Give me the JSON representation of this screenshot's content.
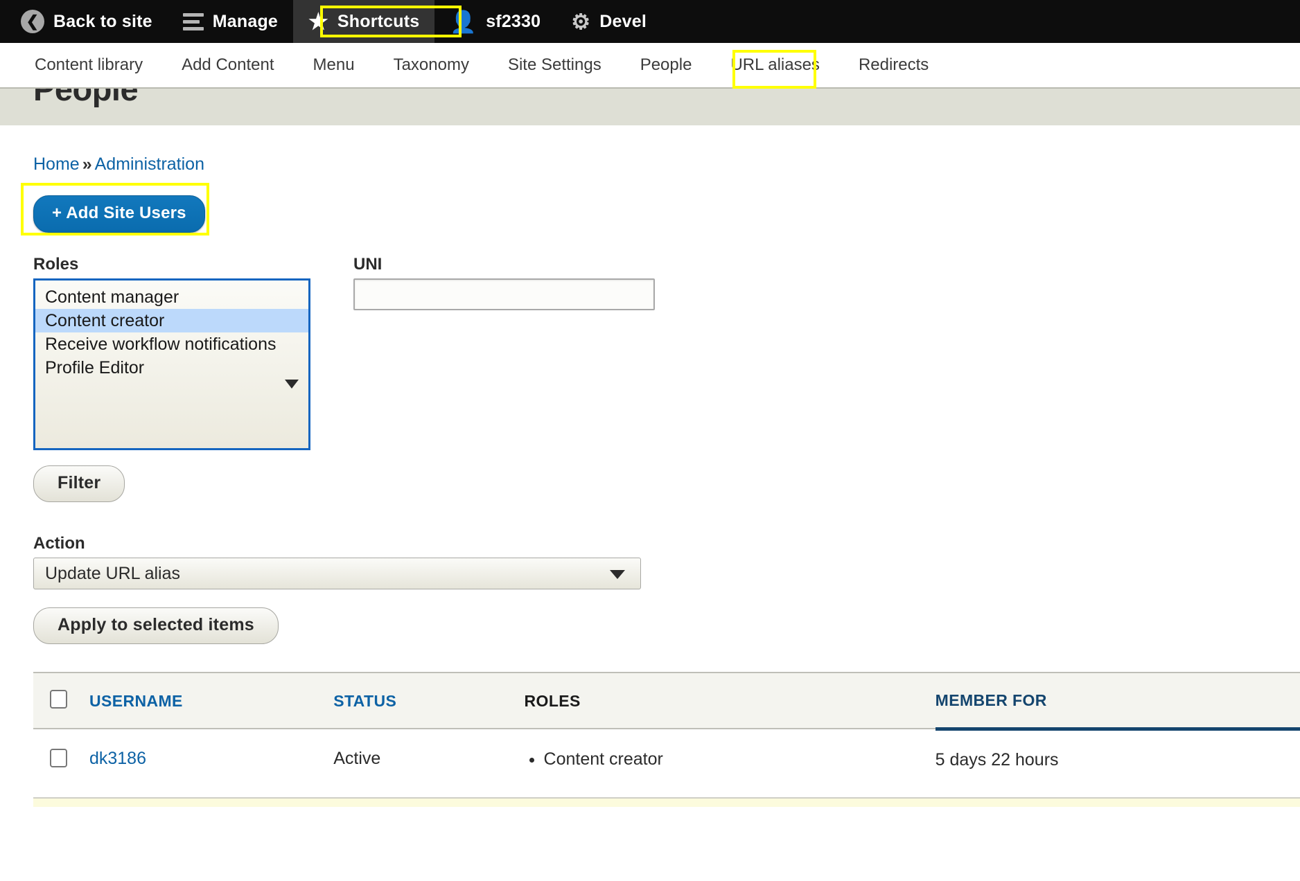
{
  "admin_toolbar": {
    "items": [
      {
        "label": "Back to site",
        "icon": "back-circle-icon",
        "active": false
      },
      {
        "label": "Manage",
        "icon": "hamburger-icon",
        "active": false
      },
      {
        "label": "Shortcuts",
        "icon": "star-icon",
        "active": true
      },
      {
        "label": "sf2330",
        "icon": "person-icon",
        "active": false
      },
      {
        "label": "Devel",
        "icon": "gear-icon",
        "active": false
      }
    ]
  },
  "sub_nav": {
    "items": [
      {
        "label": "Content library"
      },
      {
        "label": "Add Content"
      },
      {
        "label": "Menu"
      },
      {
        "label": "Taxonomy"
      },
      {
        "label": "Site Settings"
      },
      {
        "label": "People"
      },
      {
        "label": "URL aliases"
      },
      {
        "label": "Redirects"
      }
    ],
    "highlighted": "People"
  },
  "page": {
    "title": "People",
    "breadcrumb": {
      "home": "Home",
      "separator": "»",
      "current": "Administration"
    },
    "add_users_button": "+ Add Site Users"
  },
  "filters": {
    "roles_label": "Roles",
    "roles_options": [
      {
        "label": "Content manager",
        "selected": false
      },
      {
        "label": "Content creator",
        "selected": true
      },
      {
        "label": "Receive workflow notifications",
        "selected": false
      },
      {
        "label": "Profile Editor",
        "selected": false
      }
    ],
    "uni_label": "UNI",
    "uni_value": "",
    "uni_placeholder": "",
    "filter_button": "Filter"
  },
  "bulk": {
    "action_label": "Action",
    "action_selected": "Update URL alias",
    "apply_button": "Apply to selected items"
  },
  "table": {
    "columns": [
      {
        "label": "USERNAME",
        "style": "link"
      },
      {
        "label": "STATUS",
        "style": "link"
      },
      {
        "label": "ROLES",
        "style": "plain"
      },
      {
        "label": "MEMBER FOR",
        "style": "sorted"
      }
    ],
    "rows": [
      {
        "username": "dk3186",
        "status": "Active",
        "roles": [
          "Content creator"
        ],
        "member_for": "5 days 22 hours"
      }
    ]
  },
  "colors": {
    "toolbar_bg": "#0d0d0d",
    "toolbar_active": "#333333",
    "annotation": "#ffff00",
    "link": "#0d62a5",
    "primary_button": "#0a6cae",
    "banner": "#dedfd5",
    "sorted_header": "#14456e",
    "selected_option": "#bcd9fb"
  }
}
